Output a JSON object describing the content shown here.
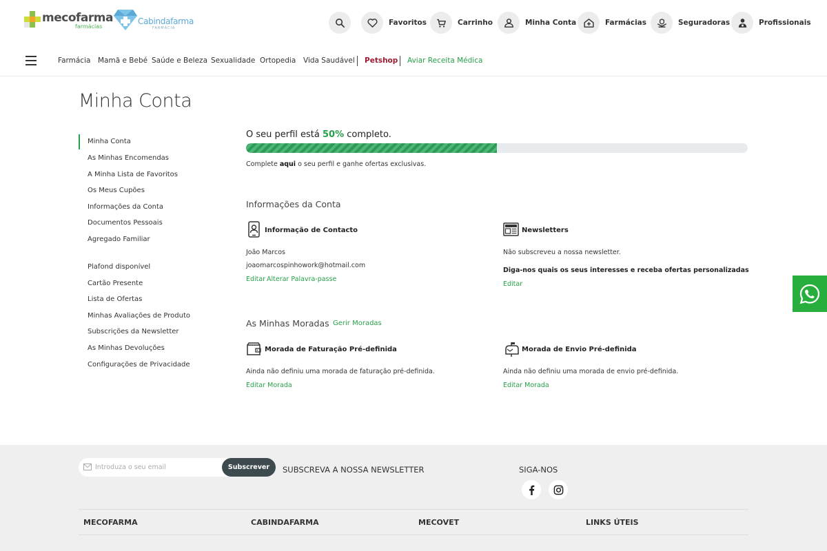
{
  "header": {
    "logo_meco_text": "mecofarma",
    "logo_meco_sub": "farmácias",
    "logo_cab_text": "Cabindafarma",
    "logo_cab_sub": "FARMÁCIA",
    "nav": {
      "search_icon": "search-icon",
      "favorites": "Favoritos",
      "cart": "Carrinho",
      "account": "Minha Conta",
      "pharmacies": "Farmácias",
      "insurers": "Seguradoras",
      "professionals": "Profissionais"
    }
  },
  "categories": {
    "items": [
      "Farmácia",
      "Mamã e Bebé",
      "Saúde e Beleza",
      "Sexualidade",
      "Ortopedia",
      "Vida Saudável"
    ],
    "petshop": "Petshop",
    "prescription": "Aviar Receita Médica"
  },
  "page": {
    "title": "Minha Conta"
  },
  "sidebar": {
    "group1": [
      "Minha Conta",
      "As Minhas Encomendas",
      "A Minha Lista de Favoritos",
      "Os Meus Cupões",
      "Informações da Conta",
      "Documentos Pessoais",
      "Agregado Familiar"
    ],
    "group2": [
      "Plafond disponível",
      "Cartão Presente",
      "Lista de Ofertas",
      "Minhas Avaliações de Produto",
      "Subscrições da Newsletter",
      "As Minhas Devoluções",
      "Configurações de Privacidade"
    ]
  },
  "profile": {
    "title_prefix": "O seu perfil está ",
    "percent_label": "50%",
    "title_suffix": " completo.",
    "percent": 50,
    "complete_prefix": "Complete ",
    "complete_link": "aqui",
    "complete_suffix": " o seu perfil e ganhe ofertas exclusivas."
  },
  "account_info": {
    "section_title": "Informações da Conta",
    "contact": {
      "title": "Informação de Contacto",
      "name": "João Marcos",
      "email": "joaomarcospinhowork@hotmail.com",
      "edit_link": "Editar",
      "change_password_link": "Alterar Palavra-passe"
    },
    "newsletters": {
      "title": "Newsletters",
      "status": "Não subscreveu a nossa newsletter.",
      "prompt": "Diga-nos quais os seus interesses e receba ofertas personalizadas",
      "edit_link": "Editar"
    }
  },
  "addresses": {
    "section_title": "As Minhas Moradas",
    "manage_link": "Gerir Moradas",
    "billing": {
      "title": "Morada de Faturação Pré-definida",
      "text": "Ainda não definiu uma morada de faturação pré-definida.",
      "edit_link": "Editar Morada"
    },
    "shipping": {
      "title": "Morada de Envio Pré-definida",
      "text": "Ainda não definiu uma morada de envio pré-definida.",
      "edit_link": "Editar Morada"
    }
  },
  "whatsapp": {
    "icon": "whatsapp-icon"
  },
  "footer": {
    "newsletter_placeholder": "Introduza o seu email",
    "subscribe_button": "Subscrever",
    "newsletter_title": "SUBSCREVA A NOSSA NEWSLETTER",
    "follow_title": "SIGA-NOS",
    "columns": [
      "MECOFARMA",
      "CABINDAFARMA",
      "MECOVET",
      "LINKS ÚTEIS"
    ]
  },
  "colors": {
    "brand_green": "#27a04a",
    "petshop_red": "#9b1b30",
    "whatsapp_green": "#27ae3c",
    "subscribe_dark": "#3d4a4e",
    "footer_bg": "#efefef"
  }
}
